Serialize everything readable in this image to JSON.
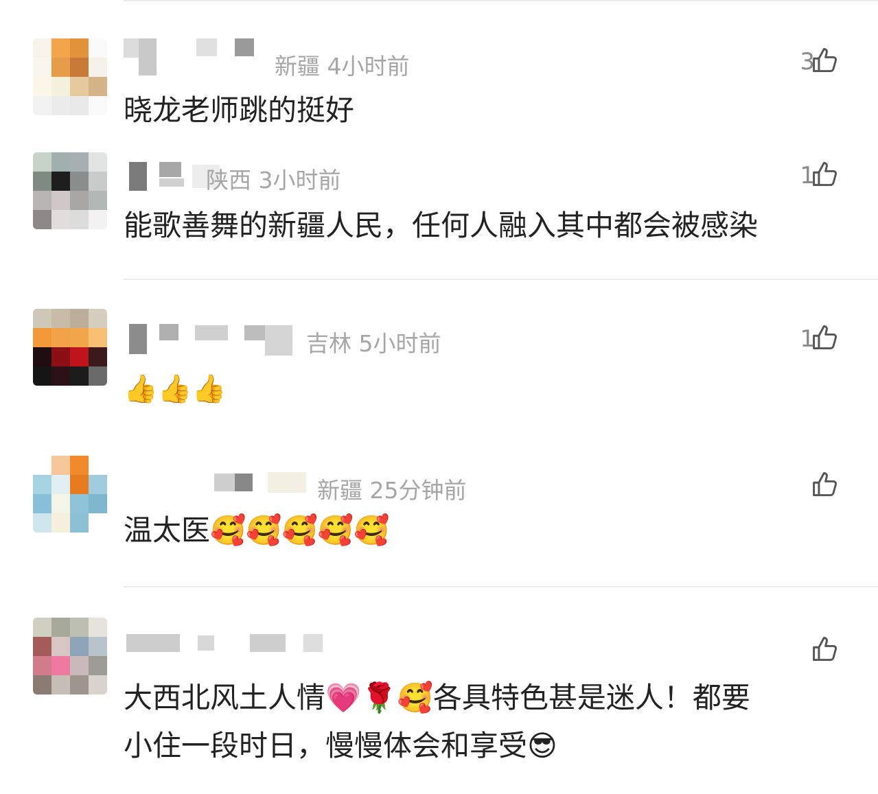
{
  "comments": [
    {
      "location": "新疆",
      "time": "4小时前",
      "likes": "3",
      "text": "晓龙老师跳的挺好"
    },
    {
      "location": "陕西",
      "time": "3小时前",
      "likes": "1",
      "text": "能歌善舞的新疆人民，任何人融入其中都会被感染"
    },
    {
      "location": "吉林",
      "time": "5小时前",
      "likes": "1",
      "text": "👍👍👍"
    },
    {
      "location": "新疆",
      "time": "25分钟前",
      "likes": "",
      "text": "温太医🥰🥰🥰🥰🥰"
    },
    {
      "location": "",
      "time": "",
      "likes": "",
      "text_line1": "大西北风土人情💗🌹🥰各具特色甚是迷人！都要",
      "text_line2": "小住一段时日，慢慢体会和享受😎"
    }
  ],
  "icons": {
    "like": "thumbs-up-icon"
  },
  "colors": {
    "meta": "#a6a6a6",
    "text": "#222222",
    "divider": "#ececec"
  }
}
